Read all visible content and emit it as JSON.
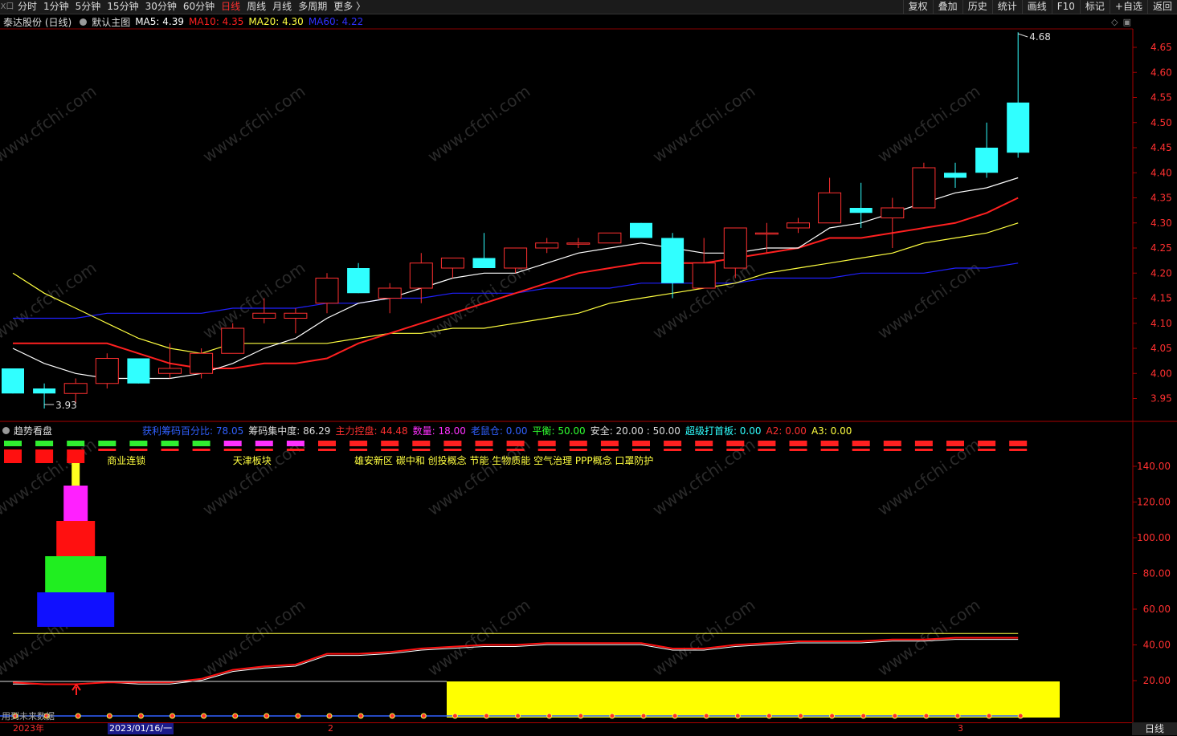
{
  "toolbar": {
    "logo": "X口",
    "periods": [
      "分时",
      "1分钟",
      "5分钟",
      "15分钟",
      "30分钟",
      "60分钟",
      "日线",
      "周线",
      "月线",
      "多周期",
      "更多 〉"
    ],
    "active_period": "日线",
    "right_buttons": [
      "复权",
      "叠加",
      "历史",
      "统计",
      "画线",
      "F10",
      "标记",
      "+自选",
      "返回"
    ]
  },
  "main_legend": {
    "stock": "泰达股份 (日线)",
    "view": "默认主图",
    "ma5": "MA5: 4.39",
    "ma10": "MA10: 4.35",
    "ma20": "MA20: 4.30",
    "ma60": "MA60: 4.22",
    "colors": {
      "ma5": "#ffffff",
      "ma10": "#ff2020",
      "ma20": "#ffff40",
      "ma60": "#3030ff"
    }
  },
  "main_price_axis": [
    "4.65",
    "4.60",
    "4.55",
    "4.50",
    "4.45",
    "4.40",
    "4.35",
    "4.30",
    "4.25",
    "4.20",
    "4.15",
    "4.10",
    "4.05",
    "4.00",
    "3.95"
  ],
  "high_label": "4.68",
  "low_label": "3.93",
  "sub_legend": {
    "title": "趋势看盘",
    "items": [
      {
        "label": "获利筹码百分比: 78.05",
        "color": "#3060ff"
      },
      {
        "label": "筹码集中度: 86.29",
        "color": "#dddddd"
      },
      {
        "label": "主力控盘: 44.48",
        "color": "#ff3030"
      },
      {
        "label": "数量: 18.00",
        "color": "#ff30ff"
      },
      {
        "label": "老鼠仓: 0.00",
        "color": "#3060ff"
      },
      {
        "label": "平衡: 50.00",
        "color": "#30ff30"
      },
      {
        "label": "安全: 20.00 : 50.00",
        "color": "#dddddd"
      },
      {
        "label": "超级打首板: 0.00",
        "color": "#30ffff"
      },
      {
        "label": "A2: 0.00",
        "color": "#ff3030"
      },
      {
        "label": "A3: 0.00",
        "color": "#ffff40"
      }
    ]
  },
  "sub_axis": [
    "140.00",
    "120.00",
    "100.00",
    "80.00",
    "60.00",
    "40.00",
    "20.00"
  ],
  "concepts": {
    "a": "商业连锁",
    "b": "天津板块",
    "c": "雄安新区  碳中和  创投概念  节能  生物质能  空气治理  PPP概念  口罩防护"
  },
  "future_note": "用到未来数据",
  "bottom": {
    "year": "2023年",
    "cursor_date": "2023/01/16/一",
    "month2": "2",
    "month3": "3",
    "period_button": "日线"
  },
  "watermark": "www.cfchi.com",
  "candles": [
    {
      "o": 4.01,
      "h": 4.01,
      "l": 3.96,
      "c": 3.96
    },
    {
      "o": 3.97,
      "h": 3.98,
      "l": 3.93,
      "c": 3.96
    },
    {
      "o": 3.96,
      "h": 3.99,
      "l": 3.94,
      "c": 3.98
    },
    {
      "o": 3.98,
      "h": 4.04,
      "l": 3.97,
      "c": 4.03
    },
    {
      "o": 4.03,
      "h": 4.03,
      "l": 3.98,
      "c": 3.98
    },
    {
      "o": 4.0,
      "h": 4.06,
      "l": 3.99,
      "c": 4.01
    },
    {
      "o": 4.0,
      "h": 4.05,
      "l": 3.99,
      "c": 4.04
    },
    {
      "o": 4.04,
      "h": 4.1,
      "l": 4.04,
      "c": 4.09
    },
    {
      "o": 4.11,
      "h": 4.15,
      "l": 4.1,
      "c": 4.12
    },
    {
      "o": 4.11,
      "h": 4.13,
      "l": 4.08,
      "c": 4.12
    },
    {
      "o": 4.14,
      "h": 4.2,
      "l": 4.12,
      "c": 4.19
    },
    {
      "o": 4.21,
      "h": 4.22,
      "l": 4.16,
      "c": 4.16
    },
    {
      "o": 4.15,
      "h": 4.18,
      "l": 4.12,
      "c": 4.17
    },
    {
      "o": 4.17,
      "h": 4.24,
      "l": 4.14,
      "c": 4.22
    },
    {
      "o": 4.21,
      "h": 4.23,
      "l": 4.19,
      "c": 4.23
    },
    {
      "o": 4.23,
      "h": 4.28,
      "l": 4.21,
      "c": 4.21
    },
    {
      "o": 4.21,
      "h": 4.25,
      "l": 4.2,
      "c": 4.25
    },
    {
      "o": 4.25,
      "h": 4.27,
      "l": 4.24,
      "c": 4.26
    },
    {
      "o": 4.26,
      "h": 4.27,
      "l": 4.25,
      "c": 4.26
    },
    {
      "o": 4.26,
      "h": 4.28,
      "l": 4.26,
      "c": 4.28
    },
    {
      "o": 4.3,
      "h": 4.3,
      "l": 4.27,
      "c": 4.27
    },
    {
      "o": 4.27,
      "h": 4.28,
      "l": 4.15,
      "c": 4.18
    },
    {
      "o": 4.17,
      "h": 4.27,
      "l": 4.17,
      "c": 4.22
    },
    {
      "o": 4.21,
      "h": 4.29,
      "l": 4.19,
      "c": 4.29
    },
    {
      "o": 4.28,
      "h": 4.3,
      "l": 4.24,
      "c": 4.28
    },
    {
      "o": 4.29,
      "h": 4.31,
      "l": 4.28,
      "c": 4.3
    },
    {
      "o": 4.3,
      "h": 4.39,
      "l": 4.3,
      "c": 4.36
    },
    {
      "o": 4.33,
      "h": 4.38,
      "l": 4.29,
      "c": 4.32
    },
    {
      "o": 4.31,
      "h": 4.35,
      "l": 4.25,
      "c": 4.33
    },
    {
      "o": 4.33,
      "h": 4.42,
      "l": 4.33,
      "c": 4.41
    },
    {
      "o": 4.4,
      "h": 4.42,
      "l": 4.37,
      "c": 4.39
    },
    {
      "o": 4.45,
      "h": 4.5,
      "l": 4.39,
      "c": 4.4
    },
    {
      "o": 4.54,
      "h": 4.68,
      "l": 4.43,
      "c": 4.44
    }
  ],
  "ma5": [
    4.05,
    4.02,
    4.0,
    3.99,
    3.99,
    3.99,
    4.0,
    4.02,
    4.05,
    4.07,
    4.11,
    4.14,
    4.15,
    4.17,
    4.19,
    4.2,
    4.2,
    4.22,
    4.24,
    4.25,
    4.26,
    4.25,
    4.24,
    4.24,
    4.25,
    4.25,
    4.29,
    4.3,
    4.32,
    4.34,
    4.36,
    4.37,
    4.39
  ],
  "ma10": [
    4.06,
    4.06,
    4.06,
    4.06,
    4.04,
    4.02,
    4.01,
    4.01,
    4.02,
    4.02,
    4.03,
    4.06,
    4.08,
    4.1,
    4.12,
    4.14,
    4.16,
    4.18,
    4.2,
    4.21,
    4.22,
    4.22,
    4.22,
    4.23,
    4.24,
    4.25,
    4.27,
    4.27,
    4.28,
    4.29,
    4.3,
    4.32,
    4.35
  ],
  "ma20": [
    4.2,
    4.16,
    4.13,
    4.1,
    4.07,
    4.05,
    4.04,
    4.06,
    4.06,
    4.06,
    4.06,
    4.07,
    4.08,
    4.08,
    4.09,
    4.09,
    4.1,
    4.11,
    4.12,
    4.14,
    4.15,
    4.16,
    4.17,
    4.18,
    4.2,
    4.21,
    4.22,
    4.23,
    4.24,
    4.26,
    4.27,
    4.28,
    4.3
  ],
  "ma60": [
    4.11,
    4.11,
    4.11,
    4.12,
    4.12,
    4.12,
    4.12,
    4.13,
    4.13,
    4.13,
    4.14,
    4.14,
    4.15,
    4.15,
    4.16,
    4.16,
    4.16,
    4.17,
    4.17,
    4.17,
    4.18,
    4.18,
    4.18,
    4.18,
    4.19,
    4.19,
    4.19,
    4.2,
    4.2,
    4.2,
    4.21,
    4.21,
    4.22
  ],
  "signal_top": [
    "#30ee30",
    "#30ee30",
    "#30ee30",
    "#30ee30",
    "#30ee30",
    "#30ee30",
    "#30ee30",
    "#ff30ff",
    "#ff30ff",
    "#ff30ff",
    "#ff2020",
    "#ff2020",
    "#ff2020",
    "#ff2020",
    "#ff2020",
    "#ff2020",
    "#ff2020",
    "#ff2020",
    "#ff2020",
    "#ff2020",
    "#ff2020",
    "#ff2020",
    "#ff2020",
    "#ff2020",
    "#ff2020",
    "#ff2020",
    "#ff2020",
    "#ff2020",
    "#ff2020",
    "#ff2020",
    "#ff2020",
    "#ff2020",
    "#ff2020"
  ],
  "signal_bottom_count": 3,
  "red_line": [
    19,
    18,
    18,
    19,
    19,
    19,
    21,
    26,
    28,
    29,
    35,
    35,
    36,
    38,
    39,
    40,
    40,
    41,
    41,
    41,
    41,
    38,
    38,
    40,
    41,
    42,
    42,
    42,
    43,
    43,
    44,
    44,
    44
  ],
  "white_line": [
    19,
    19,
    19,
    20,
    19,
    19,
    21,
    26,
    28,
    29,
    35,
    35,
    36,
    38,
    39,
    40,
    40,
    41,
    41,
    41,
    41,
    38,
    38,
    40,
    41,
    42,
    42,
    42,
    43,
    43,
    44,
    44,
    44
  ],
  "yellow_level": 50,
  "yellow_zone": {
    "from": 14,
    "to": 33
  },
  "pyramid": [
    {
      "color": "#1010ff",
      "from": 0,
      "to": 20
    },
    {
      "color": "#20ee20",
      "from": 20,
      "to": 40
    },
    {
      "color": "#ff1010",
      "from": 40,
      "to": 60
    },
    {
      "color": "#ff20ff",
      "from": 60,
      "to": 80
    },
    {
      "color": "#ffff20",
      "from": 80,
      "to": 95
    }
  ]
}
